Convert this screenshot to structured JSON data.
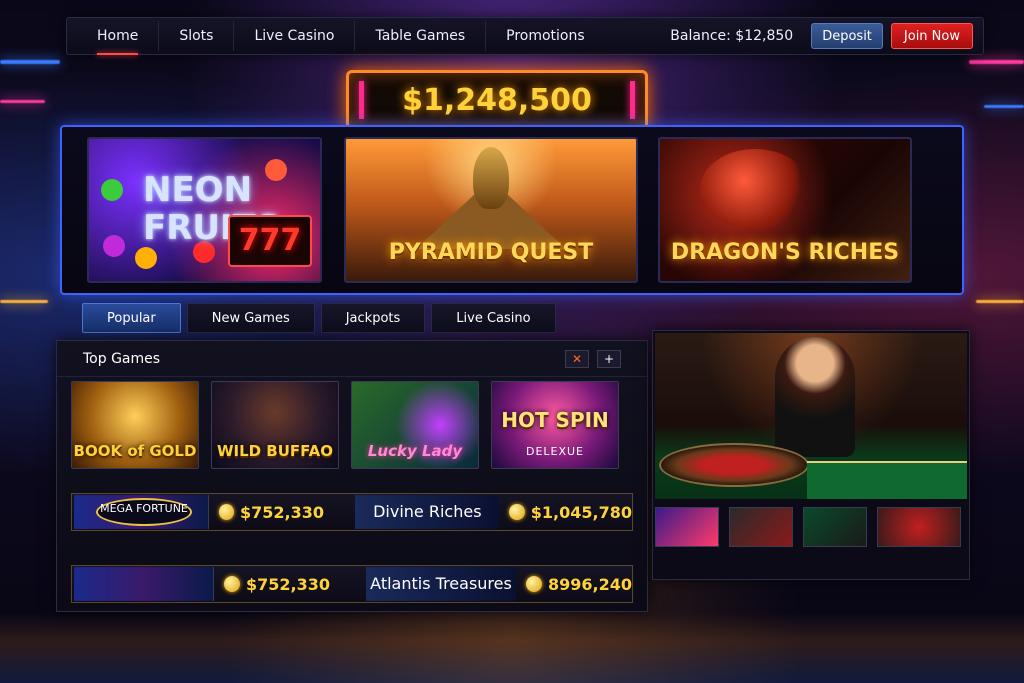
{
  "nav": {
    "items": [
      "Home",
      "Slots",
      "Live Casino",
      "Table Games",
      "Promotions"
    ],
    "balance": "Balance: $12,850",
    "deposit_label": "Deposit",
    "join_label": "Join Now"
  },
  "jackpot_marquee": "$1,248,500",
  "featured": {
    "games": [
      {
        "title": "NEON FRUITS",
        "badge": "777"
      },
      {
        "title": "PYRAMID QUEST"
      },
      {
        "title": "DRAGON'S RICHES"
      }
    ]
  },
  "category_tabs": [
    "Popular",
    "New Games",
    "Jackpots",
    "Live Casino"
  ],
  "top_games": {
    "title": "Top Games",
    "close_glyph": "✕",
    "add_glyph": "+",
    "games": [
      {
        "title": "BOOK of GOLD"
      },
      {
        "title": "WILD BUFFAO"
      },
      {
        "title": "Lucky Lady"
      },
      {
        "title": "HOT SPIN",
        "subtitle": "DELEXUE"
      }
    ],
    "jackpots": [
      {
        "logo": "MEGA FORTUNE",
        "amount": "$752,330",
        "name": "Divine Riches",
        "amount2": "$1,045,780"
      },
      {
        "amount": "$752,330",
        "name": "Atlantis Treasures",
        "amount2": "8996,240"
      }
    ]
  },
  "colors": {
    "accent_blue": "#2a4a9a",
    "join_red": "#e02020",
    "gold": "#ffd23a"
  }
}
